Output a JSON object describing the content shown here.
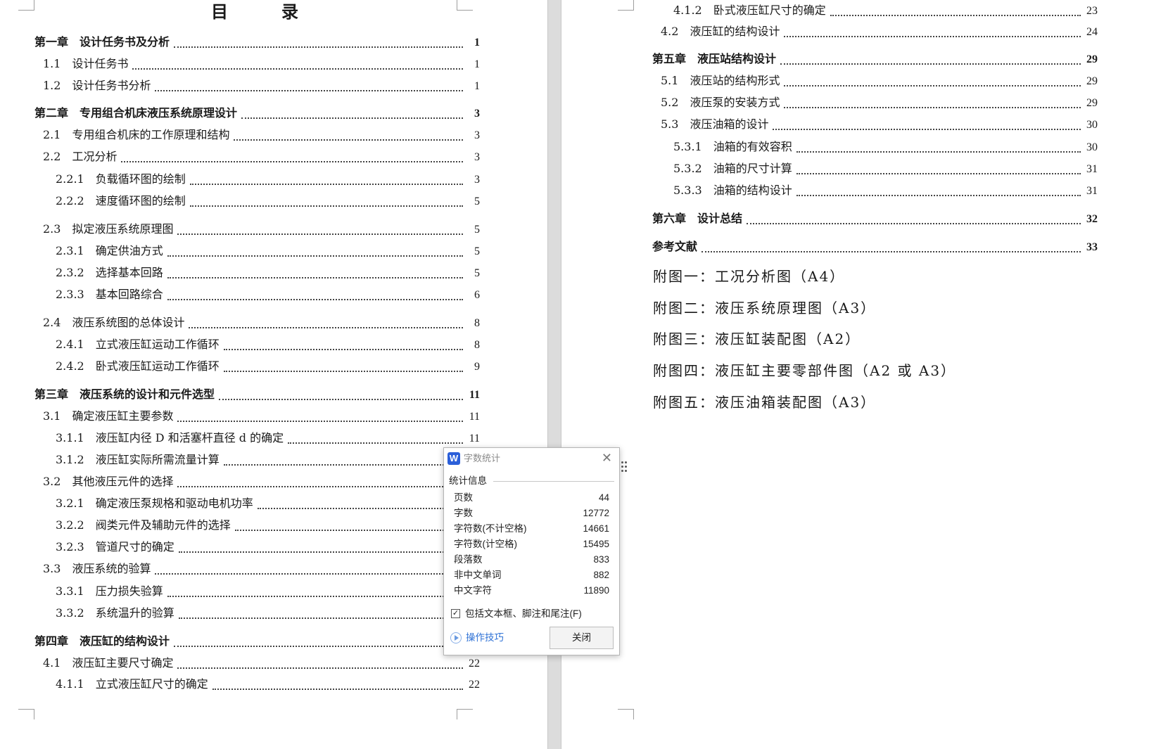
{
  "left_page": {
    "title": "目　　　录",
    "entries": [
      {
        "level": 1,
        "text": "第一章　设计任务书及分析",
        "page": "1"
      },
      {
        "level": 2,
        "text": "1.1　设计任务书",
        "page": "1"
      },
      {
        "level": 2,
        "text": "1.2　设计任务书分析",
        "page": "1"
      },
      {
        "level": 1,
        "text": "第二章　专用组合机床液压系统原理设计",
        "page": "3"
      },
      {
        "level": 2,
        "text": "2.1　专用组合机床的工作原理和结构",
        "page": "3"
      },
      {
        "level": 2,
        "text": "2.2　工况分析",
        "page": "3"
      },
      {
        "level": 3,
        "text": "2.2.1　负载循环图的绘制",
        "page": "3"
      },
      {
        "level": 3,
        "text": "2.2.2　速度循环图的绘制",
        "page": "5"
      },
      {
        "level": 2,
        "text": "2.3　拟定液压系统原理图",
        "page": "5"
      },
      {
        "level": 3,
        "text": "2.3.1　确定供油方式",
        "page": "5"
      },
      {
        "level": 3,
        "text": "2.3.2　选择基本回路",
        "page": "5"
      },
      {
        "level": 3,
        "text": "2.3.3　基本回路综合",
        "page": "6"
      },
      {
        "level": 2,
        "text": "2.4　液压系统图的总体设计",
        "page": "8"
      },
      {
        "level": 3,
        "text": "2.4.1　立式液压缸运动工作循环",
        "page": "8"
      },
      {
        "level": 3,
        "text": "2.4.2　卧式液压缸运动工作循环",
        "page": "9"
      },
      {
        "level": 1,
        "text": "第三章　液压系统的设计和元件选型",
        "page": "11"
      },
      {
        "level": 2,
        "text": "3.1　确定液压缸主要参数",
        "page": "11"
      },
      {
        "level": 3,
        "text": "3.1.1　液压缸内径 D 和活塞杆直径 d 的确定",
        "page": "11"
      },
      {
        "level": 3,
        "text": "3.1.2　液压缸实际所需流量计算",
        "page": ""
      },
      {
        "level": 2,
        "text": "3.2　其他液压元件的选择",
        "page": ""
      },
      {
        "level": 3,
        "text": "3.2.1　确定液压泵规格和驱动电机功率",
        "page": ""
      },
      {
        "level": 3,
        "text": "3.2.2　阀类元件及辅助元件的选择",
        "page": ""
      },
      {
        "level": 3,
        "text": "3.2.3　管道尺寸的确定",
        "page": ""
      },
      {
        "level": 2,
        "text": "3.3　液压系统的验算",
        "page": ""
      },
      {
        "level": 3,
        "text": "3.3.1　压力损失验算",
        "page": ""
      },
      {
        "level": 3,
        "text": "3.3.2　系统温升的验算",
        "page": ""
      },
      {
        "level": 1,
        "text": "第四章　液压缸的结构设计",
        "page": ""
      },
      {
        "level": 2,
        "text": "4.1　液压缸主要尺寸确定",
        "page": "22"
      },
      {
        "level": 3,
        "text": "4.1.1　立式液压缸尺寸的确定",
        "page": "22"
      }
    ]
  },
  "right_page": {
    "entries": [
      {
        "level": 3,
        "text": "4.1.2　卧式液压缸尺寸的确定",
        "page": "23"
      },
      {
        "level": 2,
        "text": "4.2　液压缸的结构设计",
        "page": "24"
      },
      {
        "level": 1,
        "text": "第五章　液压站结构设计",
        "page": "29"
      },
      {
        "level": 2,
        "text": "5.1　液压站的结构形式",
        "page": "29"
      },
      {
        "level": 2,
        "text": "5.2　液压泵的安装方式",
        "page": "29"
      },
      {
        "level": 2,
        "text": "5.3　液压油箱的设计",
        "page": "30"
      },
      {
        "level": 3,
        "text": "5.3.1　油箱的有效容积",
        "page": "30"
      },
      {
        "level": 3,
        "text": "5.3.2　油箱的尺寸计算",
        "page": "31"
      },
      {
        "level": 3,
        "text": "5.3.3　油箱的结构设计",
        "page": "31"
      },
      {
        "level": 1,
        "text": "第六章　设计总结",
        "page": "32"
      },
      {
        "level": 1,
        "text": "参考文献",
        "page": "33"
      }
    ],
    "appendices": [
      "附图一：工况分析图（A4）",
      "附图二：液压系统原理图（A3）",
      "附图三：液压缸装配图（A2）",
      "附图四：液压缸主要零部件图（A2 或 A3）",
      "附图五：液压油箱装配图（A3）"
    ]
  },
  "dialog": {
    "app_icon": "W",
    "title": "字数统计",
    "section_label": "统计信息",
    "stats": [
      {
        "label": "页数",
        "value": "44"
      },
      {
        "label": "字数",
        "value": "12772"
      },
      {
        "label": "字符数(不计空格)",
        "value": "14661"
      },
      {
        "label": "字符数(计空格)",
        "value": "15495"
      },
      {
        "label": "段落数",
        "value": "833"
      },
      {
        "label": "非中文单词",
        "value": "882"
      },
      {
        "label": "中文字符",
        "value": "11890"
      }
    ],
    "include_checkbox": {
      "label": "包括文本框、脚注和尾注(F)",
      "checked": true
    },
    "tips_link": "操作技巧",
    "close_button": "关闭"
  },
  "colors": {
    "link": "#2f72d6",
    "app_icon_bg": "#2b5fd9",
    "gutter": "#dcdcdc"
  },
  "icons": {
    "dialog_close": "close-icon",
    "app_icon": "wps-writer-icon",
    "tips": "play-circle-icon",
    "checkbox": "check-icon",
    "drag": "drag-handle-icon"
  }
}
